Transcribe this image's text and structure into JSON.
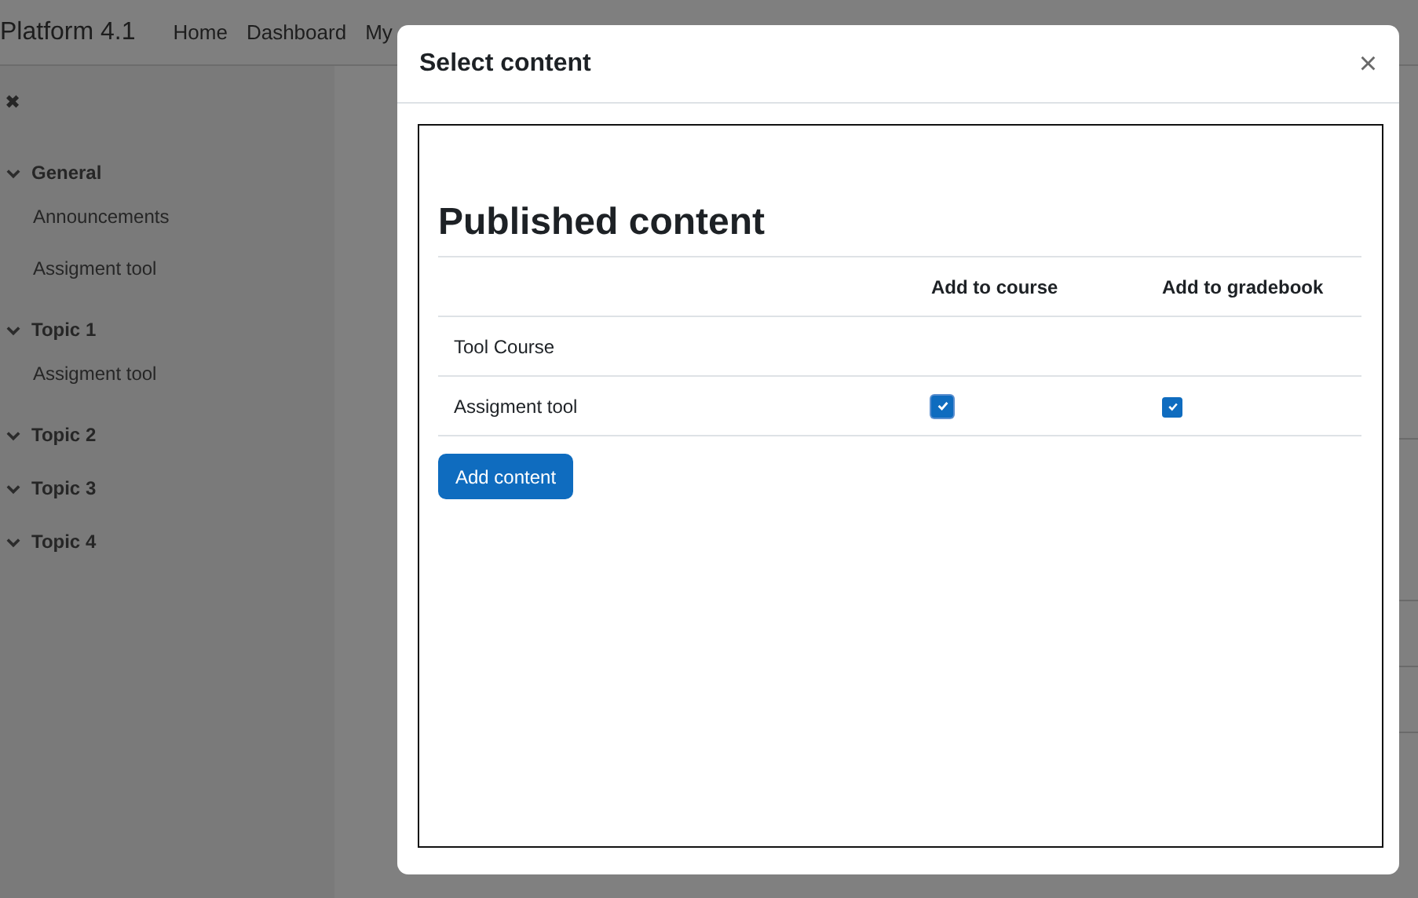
{
  "navbar": {
    "brand": "Platform 4.1",
    "links": [
      "Home",
      "Dashboard",
      "My"
    ]
  },
  "sidebar": {
    "close_glyph": "✖",
    "sections": [
      {
        "title": "General",
        "expanded": true,
        "children": [
          "Announcements",
          "Assigment tool"
        ]
      },
      {
        "title": "Topic 1",
        "expanded": true,
        "children": [
          "Assigment tool"
        ]
      },
      {
        "title": "Topic 2",
        "expanded": true
      },
      {
        "title": "Topic 3",
        "expanded": true
      },
      {
        "title": "Topic 4",
        "expanded": true
      }
    ]
  },
  "modal": {
    "title": "Select content",
    "close_glyph": "×",
    "heading": "Published content",
    "columns": [
      "Add to course",
      "Add to gradebook"
    ],
    "rows": [
      {
        "name": "Tool Course"
      },
      {
        "name": "Assigment tool",
        "add_to_course": {
          "checked": true
        },
        "add_to_gradebook": {
          "checked": true
        }
      }
    ],
    "button": "Add content"
  }
}
